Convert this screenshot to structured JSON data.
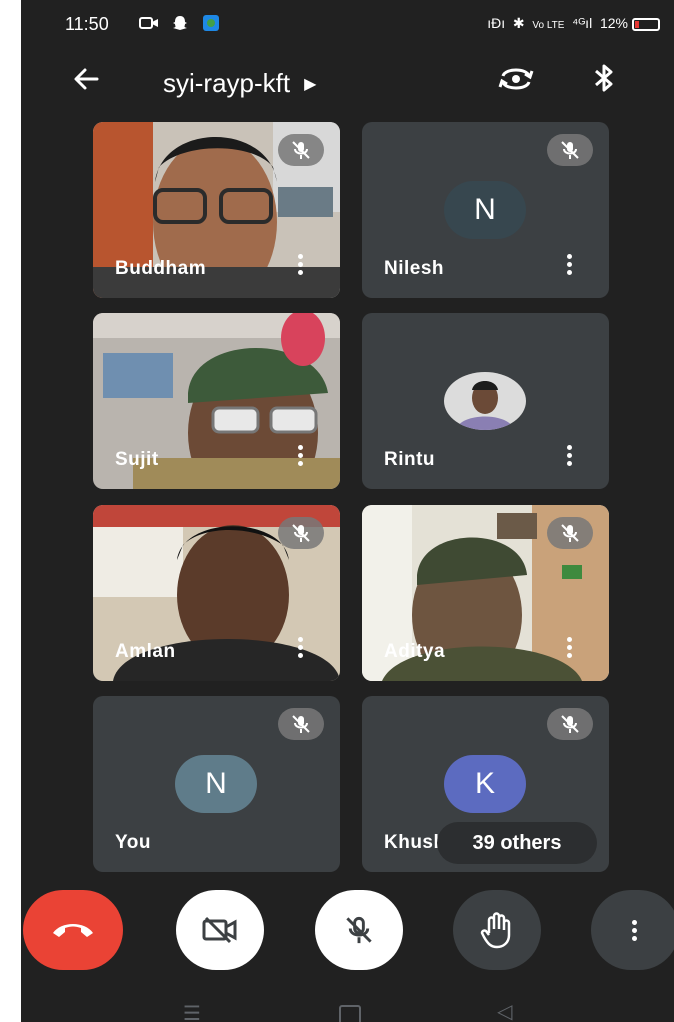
{
  "status": {
    "time": "11:50",
    "left_icons": [
      "screen-record-icon",
      "snapchat-icon",
      "app-icon"
    ],
    "right_text": "ıØı ✱ Ⓐ ⁴ᴳ 12%",
    "battery_percent": 12
  },
  "header": {
    "meeting_code": "syi-rayp-kft",
    "back_icon": "arrow-back-icon",
    "switch_camera_icon": "switch-camera-icon",
    "audio_icon": "bluetooth-icon"
  },
  "participants": [
    {
      "name": "Buddham",
      "muted": true,
      "has_video": true
    },
    {
      "name": "Nilesh",
      "muted": true,
      "has_video": false,
      "initial": "N",
      "avatar_color": "#37474f"
    },
    {
      "name": "Sujit",
      "muted": false,
      "has_video": true
    },
    {
      "name": "Rintu",
      "muted": false,
      "has_video": false,
      "photo_avatar": true
    },
    {
      "name": "Amlan",
      "muted": true,
      "has_video": true
    },
    {
      "name": "Aditya",
      "muted": true,
      "has_video": true
    },
    {
      "name": "You",
      "muted": true,
      "has_video": false,
      "initial": "N",
      "avatar_color": "#5f7c8a"
    },
    {
      "name": "Khush",
      "muted": true,
      "has_video": false,
      "initial": "K",
      "avatar_color": "#5c6bc0"
    }
  ],
  "others_label": "39 others",
  "controls": {
    "end_call_color": "#ea4335",
    "camera_off": true,
    "mic_off": true
  }
}
